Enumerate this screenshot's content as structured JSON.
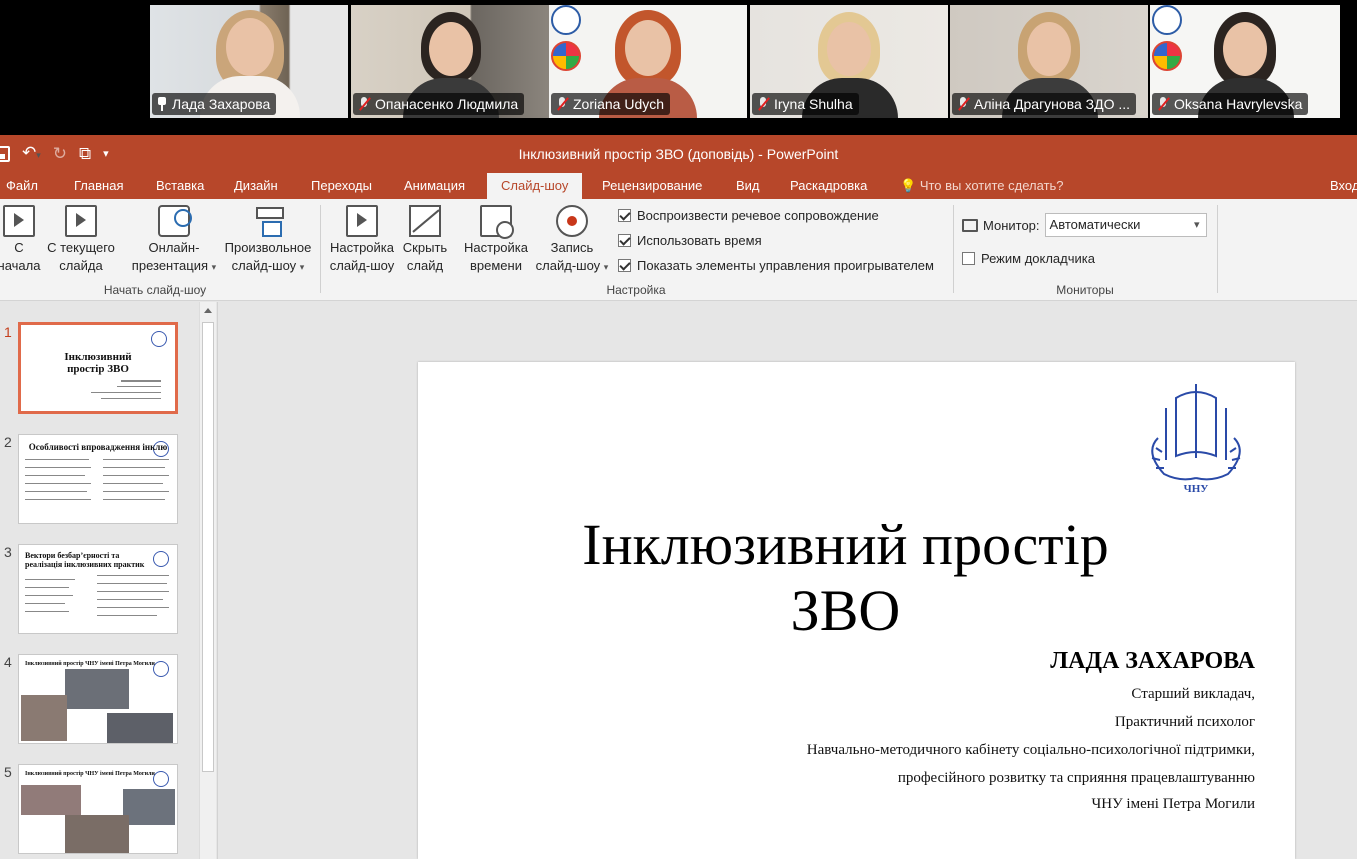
{
  "participants": [
    {
      "name": "Лада Захарова",
      "muted": false,
      "pinned": true,
      "active": true
    },
    {
      "name": "Опанасенко Людмила",
      "muted": true
    },
    {
      "name": "Zoriana Udych",
      "muted": true
    },
    {
      "name": "Iryna Shulha",
      "muted": true
    },
    {
      "name": "Аліна Драгунова ЗДО ...",
      "muted": true
    },
    {
      "name": "Oksana Havrylevska",
      "muted": true
    }
  ],
  "window": {
    "title": "Інклюзивний простір ЗВО (доповідь) - PowerPoint"
  },
  "tabs": [
    "Файл",
    "Главная",
    "Вставка",
    "Дизайн",
    "Переходы",
    "Анимация",
    "Слайд-шоу",
    "Рецензирование",
    "Вид",
    "Раскадровка"
  ],
  "tell_me": "Что вы хотите сделать?",
  "sign_in": "Вход",
  "ribbon": {
    "from_start": [
      "С",
      "начала"
    ],
    "from_current": [
      "С текущего",
      "слайда"
    ],
    "online": [
      "Онлайн-",
      "презентация"
    ],
    "custom": [
      "Произвольное",
      "слайд-шоу"
    ],
    "group_start": "Начать слайд-шоу",
    "setup": [
      "Настройка",
      "слайд-шоу"
    ],
    "hide": [
      "Скрыть",
      "слайд"
    ],
    "rehearse": [
      "Настройка",
      "времени"
    ],
    "record": [
      "Запись",
      "слайд-шоу"
    ],
    "chk_narration": "Воспроизвести речевое сопровождение",
    "chk_timings": "Использовать время",
    "chk_controls": "Показать элементы управления проигрывателем",
    "group_setup": "Настройка",
    "monitor_label": "Монитор:",
    "monitor_value": "Автоматически",
    "presenter_view": "Режим докладчика",
    "group_monitors": "Мониторы"
  },
  "thumbnails": [
    {
      "num": "1",
      "title": "Інклюзивний простір ЗВО"
    },
    {
      "num": "2",
      "title": "Особливості впровадження інклю"
    },
    {
      "num": "3",
      "title": "Вектори безбар’єрності та реалізація інклюзивних практик"
    },
    {
      "num": "4",
      "title": "Інклюзивний простір ЧНУ імені Петра Могили"
    },
    {
      "num": "5",
      "title": "Інклюзивний простір ЧНУ імені Петра Могили"
    }
  ],
  "slide": {
    "title_line1": "Інклюзивний простір",
    "title_line2": "ЗВО",
    "author": "ЛАДА ЗАХАРОВА",
    "lines": [
      "Старший викладач,",
      "Практичний психолог",
      "Навчально-методичного кабінету соціально-психологічної підтримки,",
      "професійного розвитку та сприяння працевлаштуванню",
      "ЧНУ імені Петра Могили"
    ],
    "logo_caption": "ЧНУ"
  },
  "colors": {
    "ppt_accent": "#b7472a",
    "active_speaker": "#22d06a"
  }
}
